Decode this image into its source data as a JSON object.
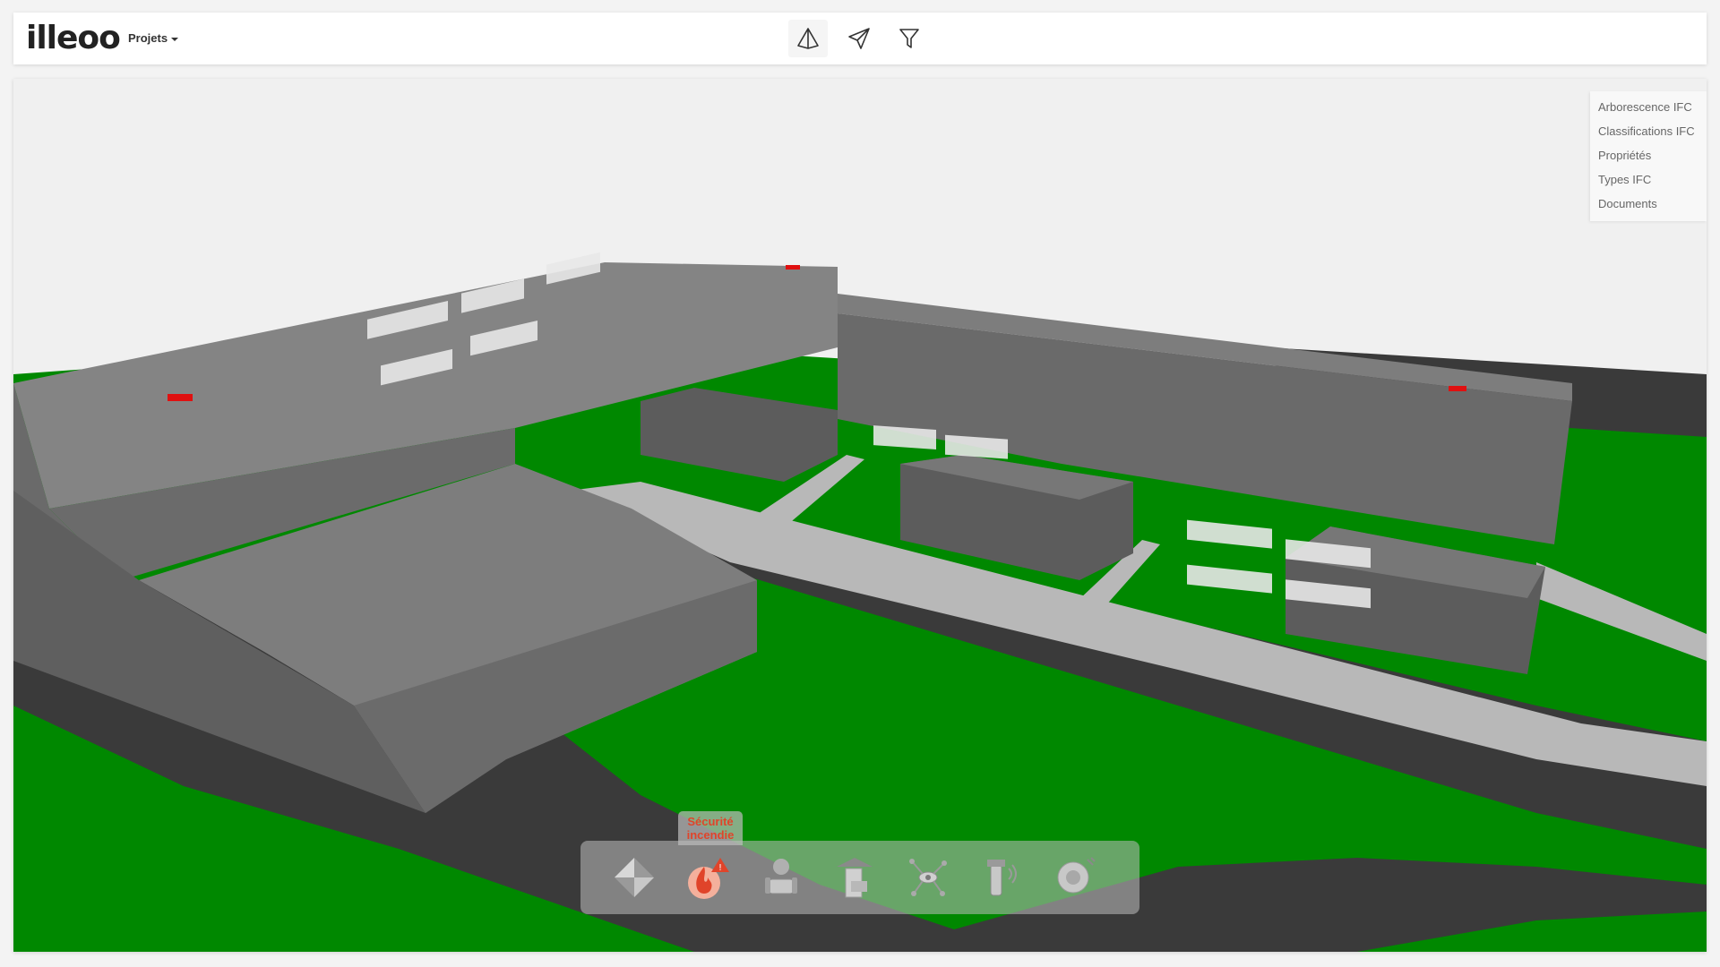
{
  "header": {
    "logo": "illeoo",
    "projects_label": "Projets",
    "tools": [
      {
        "name": "view-3d",
        "icon": "pyramid-icon"
      },
      {
        "name": "send",
        "icon": "paper-plane-icon"
      },
      {
        "name": "filter",
        "icon": "filter-icon"
      }
    ]
  },
  "right_panel": {
    "items": [
      "Arborescence IFC",
      "Classifications IFC",
      "Propriétés",
      "Types IFC",
      "Documents"
    ]
  },
  "dock": {
    "tooltip": "Sécurité incendie",
    "items": [
      {
        "name": "architecture",
        "icon": "diamond-structure-icon"
      },
      {
        "name": "fire-safety",
        "icon": "fire-alert-icon"
      },
      {
        "name": "ventilation-comfort",
        "icon": "fan-armchair-icon"
      },
      {
        "name": "electrical",
        "icon": "ceiling-panel-icon"
      },
      {
        "name": "network",
        "icon": "network-eye-icon"
      },
      {
        "name": "plumbing",
        "icon": "pipe-wireless-icon"
      },
      {
        "name": "acoustics",
        "icon": "speaker-icon"
      }
    ]
  },
  "colors": {
    "grass": "#008800",
    "building": "#7d7d7d",
    "road": "#3a3a3a",
    "path": "#b8b8b8",
    "accent": "#e0442a"
  }
}
